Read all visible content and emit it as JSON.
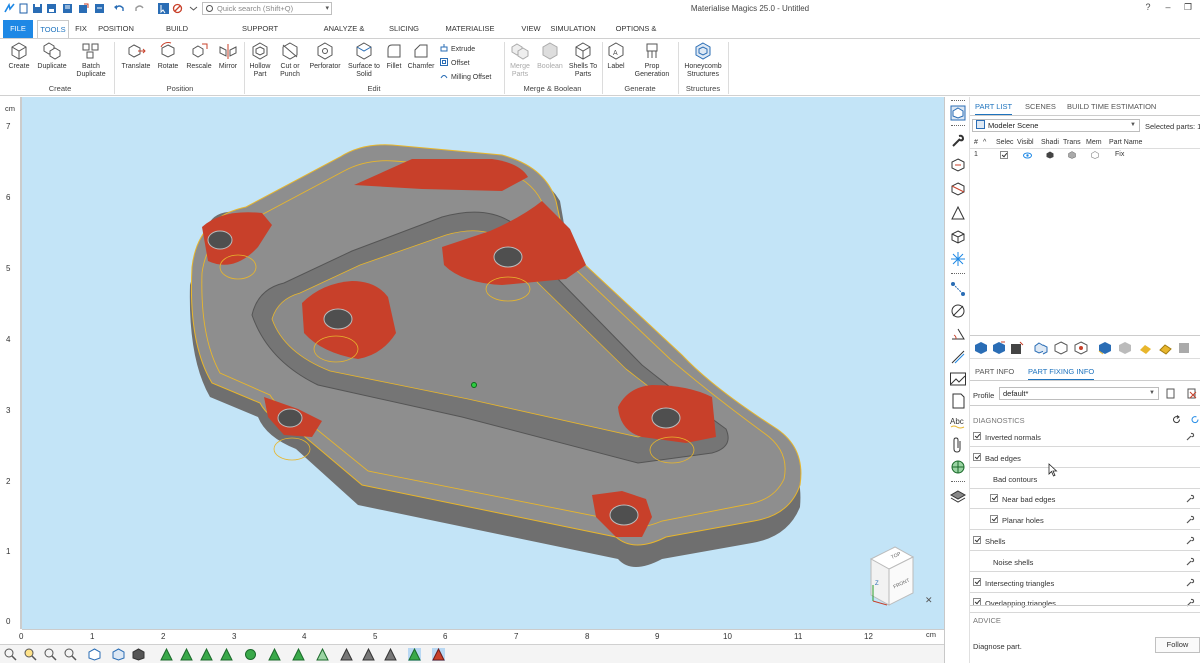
{
  "app": {
    "title": "Materialise Magics 25.0 - Untitled",
    "search_placeholder": "Quick search (Shift+Q)",
    "window_controls": [
      "?",
      "–",
      "❐"
    ]
  },
  "menu": {
    "tabs": [
      "FILE",
      "TOOLS",
      "FIX",
      "POSITION",
      "BUILD PREPARATION",
      "SUPPORT GENERATION",
      "ANALYZE & REPORT",
      "SLICING",
      "MATERIALISE SOFTWARE",
      "VIEW",
      "SIMULATION",
      "OPTIONS & HELP"
    ],
    "active": "TOOLS"
  },
  "ribbon": {
    "create": {
      "label": "Create",
      "buttons": [
        "Create",
        "Duplicate",
        "Batch Duplicate"
      ]
    },
    "position": {
      "label": "Position",
      "buttons": [
        "Translate",
        "Rotate",
        "Rescale",
        "Mirror"
      ]
    },
    "edit": {
      "label": "Edit",
      "buttons": [
        "Hollow Part",
        "Cut or Punch",
        "Perforator",
        "Surface to Solid",
        "Fillet",
        "Chamfer"
      ],
      "small": [
        "Extrude",
        "Offset",
        "Milling Offset"
      ]
    },
    "merge": {
      "label": "Merge & Boolean",
      "buttons": [
        "Merge Parts",
        "Boolean",
        "Shells To Parts"
      ]
    },
    "generate": {
      "label": "Generate",
      "buttons": [
        "Label",
        "Prop Generation"
      ]
    },
    "structures": {
      "label": "Structures",
      "buttons": [
        "Honeycomb Structures"
      ]
    }
  },
  "rulers": {
    "unit": "cm",
    "vertical": [
      "7",
      "6",
      "5",
      "4",
      "3",
      "2",
      "1",
      "0"
    ],
    "horizontal": [
      "0",
      "1",
      "2",
      "3",
      "4",
      "5",
      "6",
      "7",
      "8",
      "9",
      "10",
      "11",
      "12"
    ]
  },
  "viewcube": {
    "top": "TOP",
    "front": "FRONT",
    "axis_z": "Z",
    "close": "✕"
  },
  "panel": {
    "tabs": [
      "PART LIST",
      "SCENES",
      "BUILD TIME ESTIMATION"
    ],
    "active_tab": "PART LIST",
    "scene": "Modeler Scene",
    "selected_parts_label": "Selected parts: 1",
    "columns": [
      "#",
      "^",
      "Selec",
      "Visibl",
      "Shadi",
      "Trans",
      "Mem",
      "Part Name"
    ],
    "rows": [
      {
        "index": "1",
        "name": "Fix"
      }
    ],
    "info_tabs": [
      "PART INFO",
      "PART FIXING INFO"
    ],
    "active_info_tab": "PART FIXING INFO",
    "profile_label": "Profile",
    "profile_value": "default*",
    "diagnostics_label": "DIAGNOSTICS",
    "diagnostics": [
      {
        "label": "Inverted normals",
        "checked": true,
        "indent": 0,
        "tool": true
      },
      {
        "label": "Bad edges",
        "checked": true,
        "indent": 0,
        "tool": false
      },
      {
        "label": "Bad contours",
        "checked": null,
        "indent": 1,
        "tool": false
      },
      {
        "label": "Near bad edges",
        "checked": true,
        "indent": 1,
        "tool": true
      },
      {
        "label": "Planar holes",
        "checked": true,
        "indent": 1,
        "tool": true
      },
      {
        "label": "Shells",
        "checked": true,
        "indent": 0,
        "tool": true
      },
      {
        "label": "Noise shells",
        "checked": null,
        "indent": 1,
        "tool": true
      },
      {
        "label": "Intersecting triangles",
        "checked": true,
        "indent": 0,
        "tool": true
      },
      {
        "label": "Overlapping triangles",
        "checked": true,
        "indent": 0,
        "tool": true
      }
    ],
    "advice_label": "ADVICE",
    "advice_text": "Diagnose part.",
    "follow_label": "Follow"
  },
  "colors": {
    "accent": "#1e88e5",
    "viewport": "#c3e4f7",
    "part_gray": "#8e8e8e",
    "part_red": "#c8402a",
    "contour": "#e8b62c"
  }
}
